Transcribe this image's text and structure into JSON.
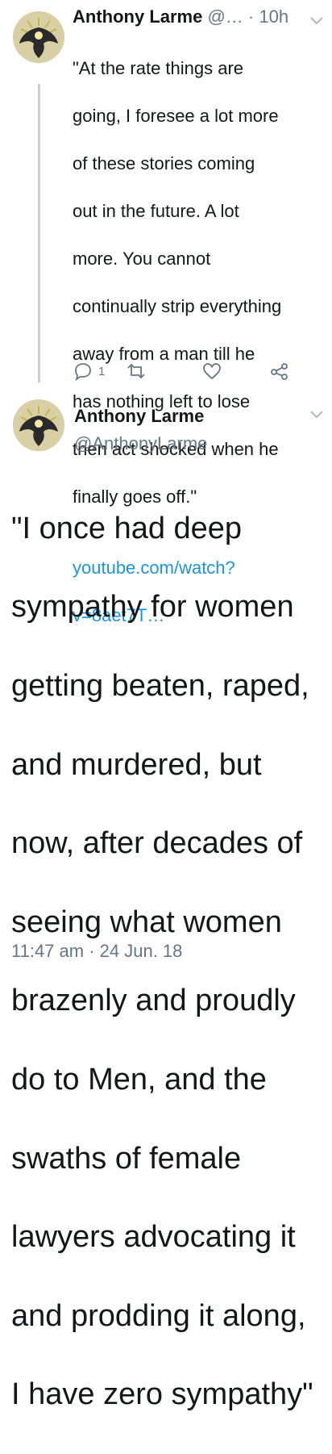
{
  "colors": {
    "accent": "#1b95e0",
    "secondary_text": "#657786",
    "thread_line": "#c9d1d8"
  },
  "tweet1": {
    "name": "Anthony Larme",
    "meta": " @… · 10h",
    "text_lines": [
      "\"At the rate things are",
      "going, I foresee a lot more",
      "of these stories coming",
      "out in the future. A lot",
      "more. You cannot",
      "continually strip everything",
      "away from a man till he",
      "has nothing left to lose",
      "then act shocked when he",
      "finally goes off.\""
    ],
    "link_lines": [
      "youtube.com/watch?",
      "v=8aet7T…"
    ],
    "reply_count": "1",
    "icons": [
      "reply-icon",
      "retweet-icon",
      "like-icon",
      "share-icon",
      "chevron-down-icon"
    ]
  },
  "tweet2": {
    "name": "Anthony Larme",
    "handle": "@AnthonyLarme",
    "text_lines": [
      "\"I once had deep",
      "sympathy for women",
      "getting beaten, raped,",
      "and murdered,  but",
      "now, after decades of",
      "seeing what women",
      "brazenly and proudly",
      "do to  Men, and the",
      "swaths of female",
      "lawyers advocating it",
      "and prodding it  along,",
      "I have zero sympathy\""
    ],
    "timestamp": "11:47 am · 24 Jun. 18"
  }
}
